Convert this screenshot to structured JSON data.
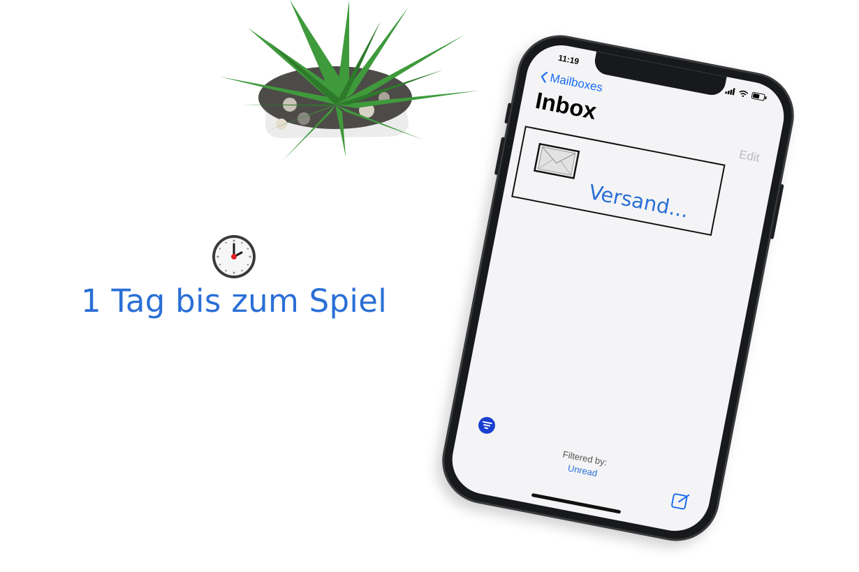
{
  "countdown": {
    "icon": "clock-icon",
    "text": "1 Tag bis zum Spiel",
    "color": "#2a6fd6"
  },
  "phone": {
    "status_time": "11:19",
    "nav_back_label": "Mailboxes",
    "title": "Inbox",
    "edit_label": "Edit",
    "messages": [
      {
        "icon": "envelope-icon",
        "sender": "Versand..."
      }
    ],
    "footer": {
      "filter_icon": "filter-icon",
      "filtered_by_label": "Filtered by:",
      "filter_value": "Unread",
      "compose_icon": "compose-icon"
    },
    "accent_color": "#1a6cf0"
  }
}
